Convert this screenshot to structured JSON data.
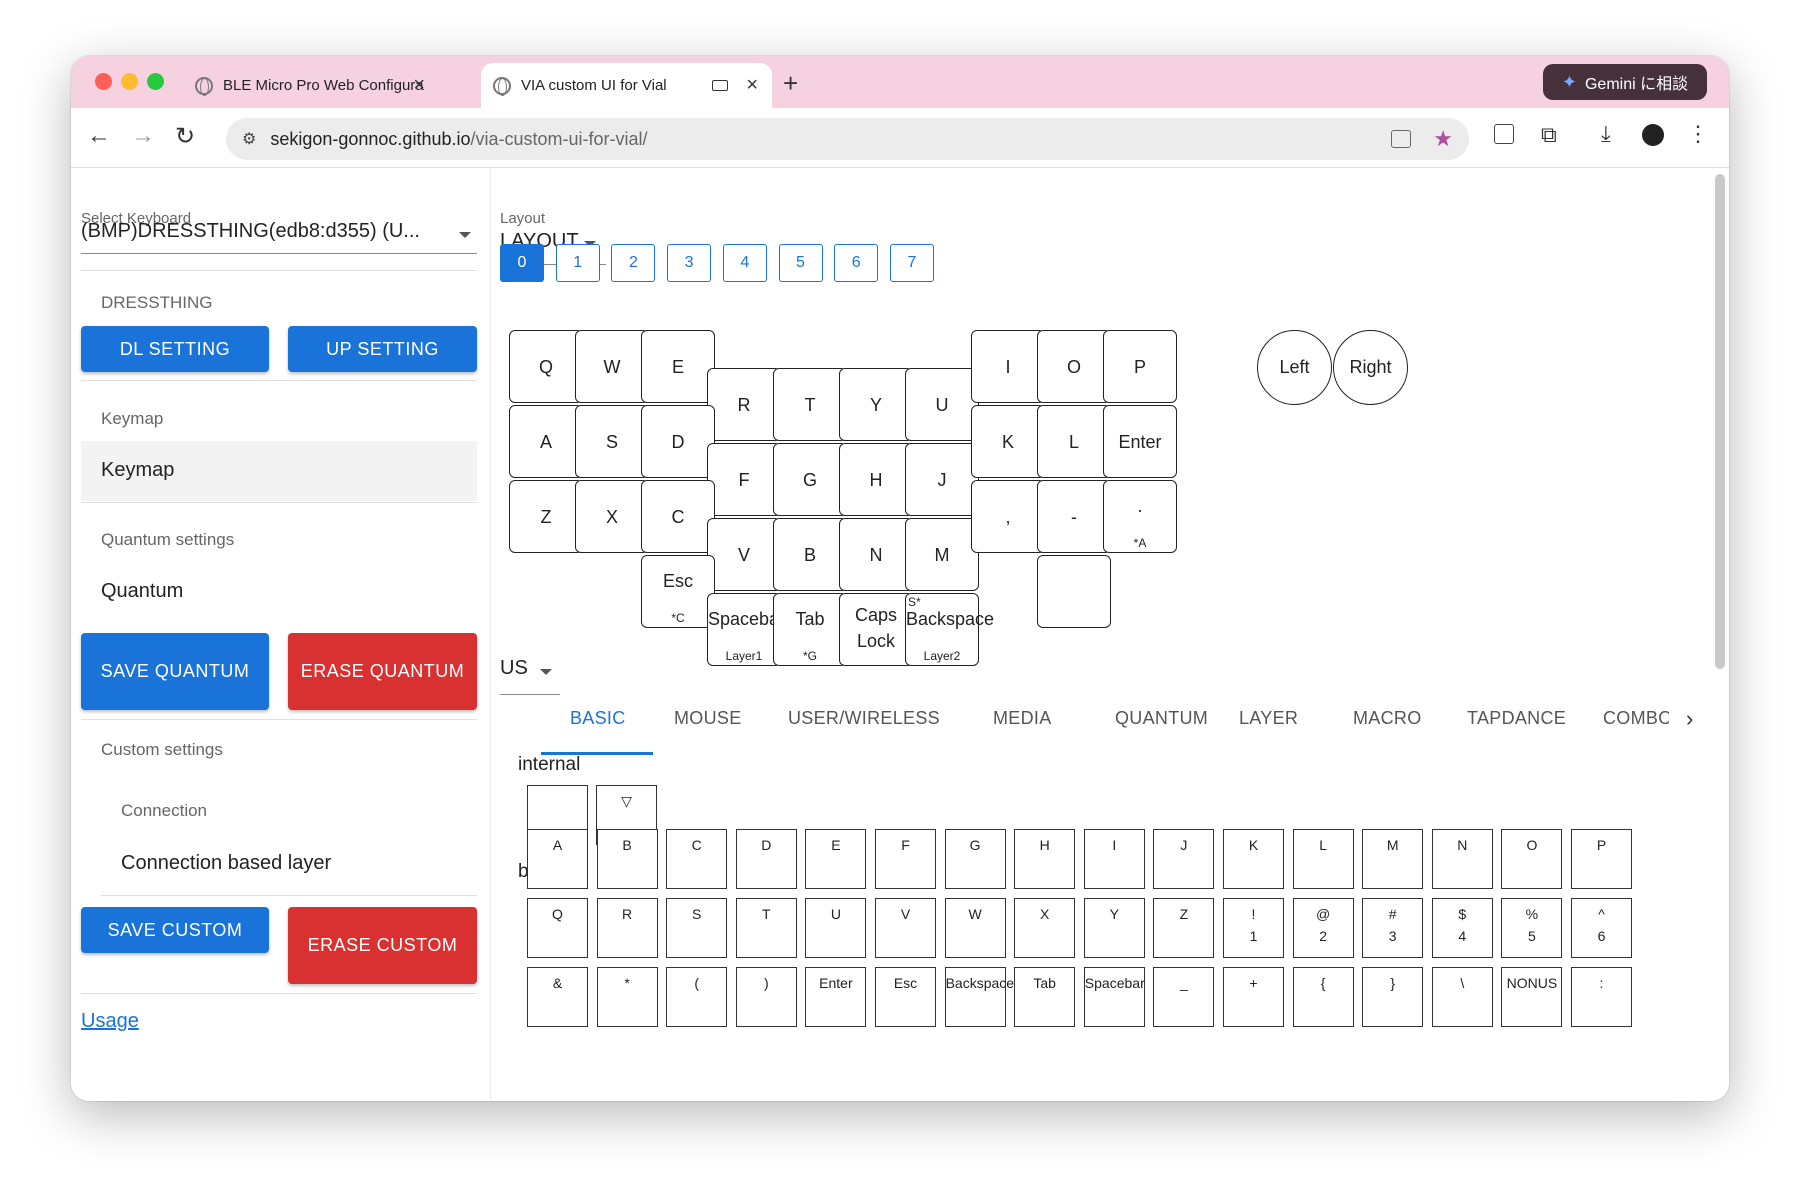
{
  "browser": {
    "tabs": [
      {
        "title": "BLE Micro Pro Web Configura",
        "close": "×"
      },
      {
        "title": "VIA custom UI for Vial",
        "close": "×"
      }
    ],
    "new_tab": "+",
    "gemini": "Gemini に相談",
    "url_host": "sekigon-gonnoc.github.io",
    "url_path": "/via-custom-ui-for-vial/"
  },
  "sidebar": {
    "select_label": "Select Keyboard",
    "select_value": "(BMP)DRESSTHING(edb8:d355) (U...",
    "keyboard_name": "DRESSTHING",
    "dl_setting": "DL SETTING",
    "up_setting": "UP SETTING",
    "keymap_section": "Keymap",
    "keymap_item": "Keymap",
    "quantum_section": "Quantum settings",
    "quantum_item": "Quantum",
    "save_quantum": "SAVE QUANTUM",
    "erase_quantum": "ERASE QUANTUM",
    "custom_section": "Custom settings",
    "connection_section": "Connection",
    "connection_item": "Connection based layer",
    "save_custom": "SAVE CUSTOM",
    "erase_custom": "ERASE CUSTOM",
    "usage_link": "Usage"
  },
  "main": {
    "layout_label": "Layout",
    "layout_value": "LAYOUT",
    "layers": [
      "0",
      "1",
      "2",
      "3",
      "4",
      "5",
      "6",
      "7"
    ],
    "selected_layer": "0",
    "keys": {
      "q": "Q",
      "w": "W",
      "e": "E",
      "r": "R",
      "t": "T",
      "y": "Y",
      "u": "U",
      "i": "I",
      "o": "O",
      "p": "P",
      "a": "A",
      "s": "S",
      "d": "D",
      "f": "F",
      "g": "G",
      "h": "H",
      "j": "J",
      "k": "K",
      "l": "L",
      "enter": "Enter",
      "z": "Z",
      "x": "X",
      "c": "C",
      "v": "V",
      "b": "B",
      "n": "N",
      "m": "M",
      "comma": ",",
      "minus": "-",
      "dot": ".",
      "dot_sub": "*A",
      "esc": "Esc",
      "esc_sub": "*C",
      "space": "Spacebar",
      "space_sub": "Layer1",
      "tab": "Tab",
      "tab_sub": "*G",
      "caps1": "Caps",
      "caps2": "Lock",
      "bs": "Backspace",
      "bs_sub": "Layer2",
      "bs_corner": "S*"
    },
    "encoders": {
      "left": "Left",
      "right": "Right"
    },
    "lang": "US",
    "keycode_tabs": [
      "BASIC",
      "MOUSE",
      "USER/WIRELESS",
      "MEDIA",
      "QUANTUM",
      "LAYER",
      "MACRO",
      "TAPDANCE",
      "COMBO"
    ],
    "active_keycode_tab": "BASIC",
    "internal_label": "internal",
    "internal_triangle": "▽",
    "basic_label": "basic",
    "row1": [
      "A",
      "B",
      "C",
      "D",
      "E",
      "F",
      "G",
      "H",
      "I",
      "J",
      "K",
      "L",
      "M",
      "N",
      "O",
      "P"
    ],
    "row2": [
      [
        "Q",
        ""
      ],
      [
        "R",
        ""
      ],
      [
        "S",
        ""
      ],
      [
        "T",
        ""
      ],
      [
        "U",
        ""
      ],
      [
        "V",
        ""
      ],
      [
        "W",
        ""
      ],
      [
        "X",
        ""
      ],
      [
        "Y",
        ""
      ],
      [
        "Z",
        ""
      ],
      [
        "!",
        "1"
      ],
      [
        "@",
        "2"
      ],
      [
        "#",
        "3"
      ],
      [
        "$",
        "4"
      ],
      [
        "%",
        "5"
      ],
      [
        "^",
        "6"
      ]
    ],
    "row3": [
      "&",
      "*",
      "(",
      ")",
      "Enter",
      "Esc",
      "Backspace",
      "Tab",
      "Spacebar",
      "_",
      "+",
      "{",
      "}",
      "\\",
      "NONUS",
      ":"
    ]
  }
}
